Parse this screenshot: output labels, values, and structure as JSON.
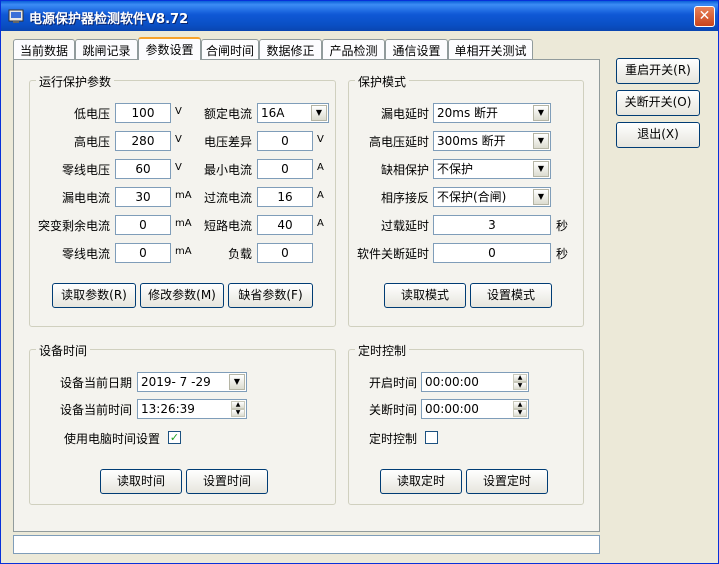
{
  "window": {
    "title": "电源保护器检测软件V8.72",
    "close_symbol": "✕"
  },
  "tabs": [
    "当前数据",
    "跳闸记录",
    "参数设置",
    "合闸时间",
    "数据修正",
    "产品检测",
    "通信设置",
    "单相开关测试"
  ],
  "active_tab": "参数设置",
  "side_buttons": {
    "restart": "重启开关(R)",
    "disconnect": "关断开关(O)",
    "exit": "退出(X)"
  },
  "run_params": {
    "title": "运行保护参数",
    "left_fields": [
      {
        "label": "低电压",
        "value": "100",
        "unit": "V"
      },
      {
        "label": "高电压",
        "value": "280",
        "unit": "V"
      },
      {
        "label": "零线电压",
        "value": "60",
        "unit": "V"
      },
      {
        "label": "漏电电流",
        "value": "30",
        "unit": "mA"
      },
      {
        "label": "突变剩余电流",
        "value": "0",
        "unit": "mA"
      },
      {
        "label": "零线电流",
        "value": "0",
        "unit": "mA"
      }
    ],
    "right_fields": [
      {
        "label": "额定电流",
        "value": "16A",
        "unit": ""
      },
      {
        "label": "电压差异",
        "value": "0",
        "unit": "V"
      },
      {
        "label": "最小电流",
        "value": "0",
        "unit": "A"
      },
      {
        "label": "过流电流",
        "value": "16",
        "unit": "A"
      },
      {
        "label": "短路电流",
        "value": "40",
        "unit": "A"
      },
      {
        "label": "负载",
        "value": "0",
        "unit": ""
      }
    ],
    "buttons": {
      "read": "读取参数(R)",
      "modify": "修改参数(M)",
      "default": "缺省参数(F)"
    }
  },
  "protect_mode": {
    "title": "保护模式",
    "fields": [
      {
        "label": "漏电延时",
        "value": "20ms 断开",
        "unit": ""
      },
      {
        "label": "高电压延时",
        "value": "300ms 断开",
        "unit": ""
      },
      {
        "label": "缺相保护",
        "value": "不保护",
        "unit": ""
      },
      {
        "label": "相序接反",
        "value": "不保护(合闸)",
        "unit": ""
      },
      {
        "label": "过载延时",
        "value": "3",
        "unit": "秒"
      },
      {
        "label": "软件关断延时",
        "value": "0",
        "unit": "秒"
      }
    ],
    "buttons": {
      "read": "读取模式",
      "set": "设置模式"
    }
  },
  "device_time": {
    "title": "设备时间",
    "date_label": "设备当前日期",
    "date_value": "2019- 7 -29",
    "time_label": "设备当前时间",
    "time_value": "13:26:39",
    "use_pc_label": "使用电脑时间设置",
    "use_pc_checked": "✓",
    "buttons": {
      "read": "读取时间",
      "set": "设置时间"
    }
  },
  "timer_control": {
    "title": "定时控制",
    "on_label": "开启时间",
    "on_value": "00:00:00",
    "off_label": "关断时间",
    "off_value": "00:00:00",
    "enable_label": "定时控制",
    "enable_checked": "",
    "buttons": {
      "read": "读取定时",
      "set": "设置定时"
    }
  },
  "status": {
    "text": ""
  }
}
